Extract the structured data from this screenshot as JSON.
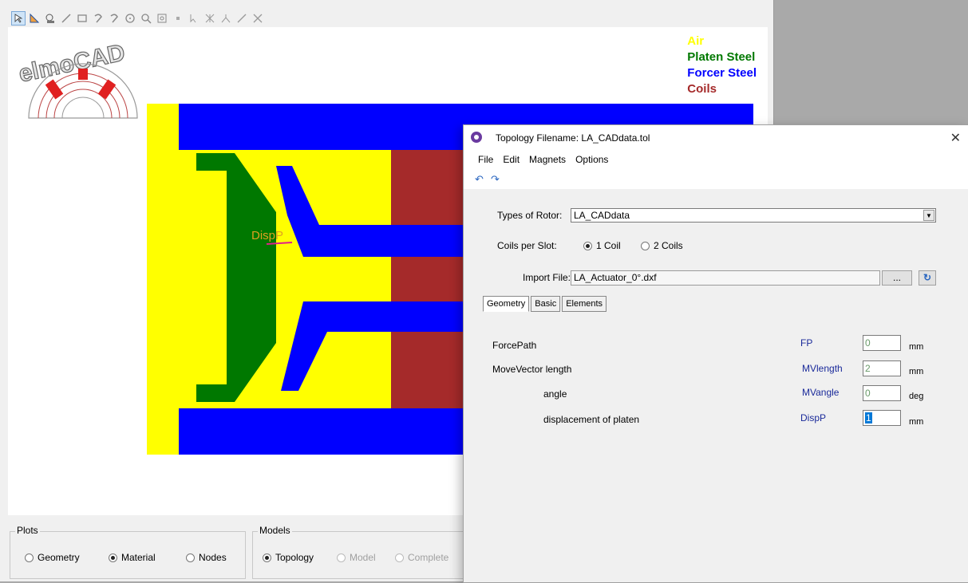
{
  "app": {
    "name": "elmoCAD"
  },
  "toolbar": {
    "tools": [
      "select-arrow-icon",
      "triangle-icon",
      "zoom-window-icon",
      "line-icon",
      "rectangle-icon",
      "arc-icon",
      "arc2-icon",
      "circle-icon",
      "zoom-icon",
      "fit-icon",
      "point-icon",
      "node-select-icon",
      "node-delete-icon",
      "segment-icon",
      "diagonal-icon",
      "cross-icon"
    ]
  },
  "legend": [
    {
      "label": "Air",
      "color": "#ffff00"
    },
    {
      "label": "Platen Steel",
      "color": "#007800"
    },
    {
      "label": "Forcer Steel",
      "color": "#0000ff"
    },
    {
      "label": "Coils",
      "color": "#a52a2a"
    }
  ],
  "canvas": {
    "disp_label": "DispP"
  },
  "bottom": {
    "plots": {
      "title": "Plots",
      "options": [
        {
          "label": "Geometry",
          "selected": false
        },
        {
          "label": "Material",
          "selected": true
        },
        {
          "label": "Nodes",
          "selected": false
        }
      ]
    },
    "models": {
      "title": "Models",
      "options": [
        {
          "label": "Topology",
          "selected": true
        },
        {
          "label": "Model",
          "selected": false
        },
        {
          "label": "Complete",
          "selected": false
        }
      ]
    }
  },
  "dialog": {
    "title": "Topology Filename: LA_CADdata.tol",
    "menu": [
      "File",
      "Edit",
      "Magnets",
      "Options"
    ],
    "rotor_label": "Types of Rotor:",
    "rotor_value": "LA_CADdata",
    "coils_label": "Coils per Slot:",
    "coils_options": [
      "1 Coil",
      "2 Coils"
    ],
    "import_label": "Import File:",
    "import_value": "LA_Actuator_0°.dxf",
    "browse_label": "...",
    "tabs": [
      "Geometry",
      "Basic",
      "Elements"
    ],
    "params": [
      {
        "label": "ForcePath",
        "var": "FP",
        "value": "0",
        "unit": "mm"
      },
      {
        "label": "MoveVector length",
        "var": "MVlength",
        "value": "2",
        "unit": "mm"
      },
      {
        "label": "angle",
        "var": "MVangle",
        "value": "0",
        "unit": "deg"
      },
      {
        "label": "displacement of platen",
        "var": "DispP",
        "value": "1",
        "unit": "mm"
      }
    ]
  }
}
